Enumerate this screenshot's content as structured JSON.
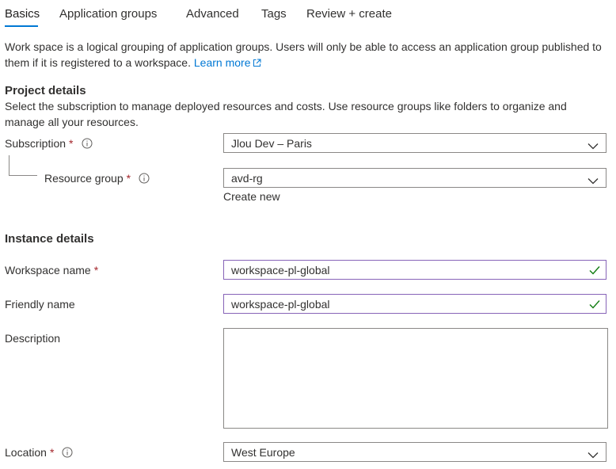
{
  "tabs": [
    {
      "label": "Basics",
      "active": true
    },
    {
      "label": "Application groups",
      "active": false
    },
    {
      "label": "Advanced",
      "active": false
    },
    {
      "label": "Tags",
      "active": false
    },
    {
      "label": "Review + create",
      "active": false
    }
  ],
  "intro": {
    "text": "Work space is a logical grouping of application groups. Users will only be able to access an application group published to them if it is registered to a workspace.",
    "learn_more": "Learn more"
  },
  "project": {
    "title": "Project details",
    "description": "Select the subscription to manage deployed resources and costs. Use resource groups like folders to organize and manage all your resources.",
    "subscription_label": "Subscription",
    "subscription_value": "Jlou Dev – Paris",
    "resource_group_label": "Resource group",
    "resource_group_value": "avd-rg",
    "create_new": "Create new"
  },
  "instance": {
    "title": "Instance details",
    "workspace_name_label": "Workspace name",
    "workspace_name_value": "workspace-pl-global",
    "friendly_name_label": "Friendly name",
    "friendly_name_value": "workspace-pl-global",
    "description_label": "Description",
    "description_value": "",
    "location_label": "Location",
    "location_value": "West Europe"
  },
  "required_marker": "*",
  "colors": {
    "accent": "#0078d4",
    "required": "#a4262c",
    "valid_border": "#8764b8",
    "valid_check": "#107c10",
    "border": "#8a8886"
  }
}
